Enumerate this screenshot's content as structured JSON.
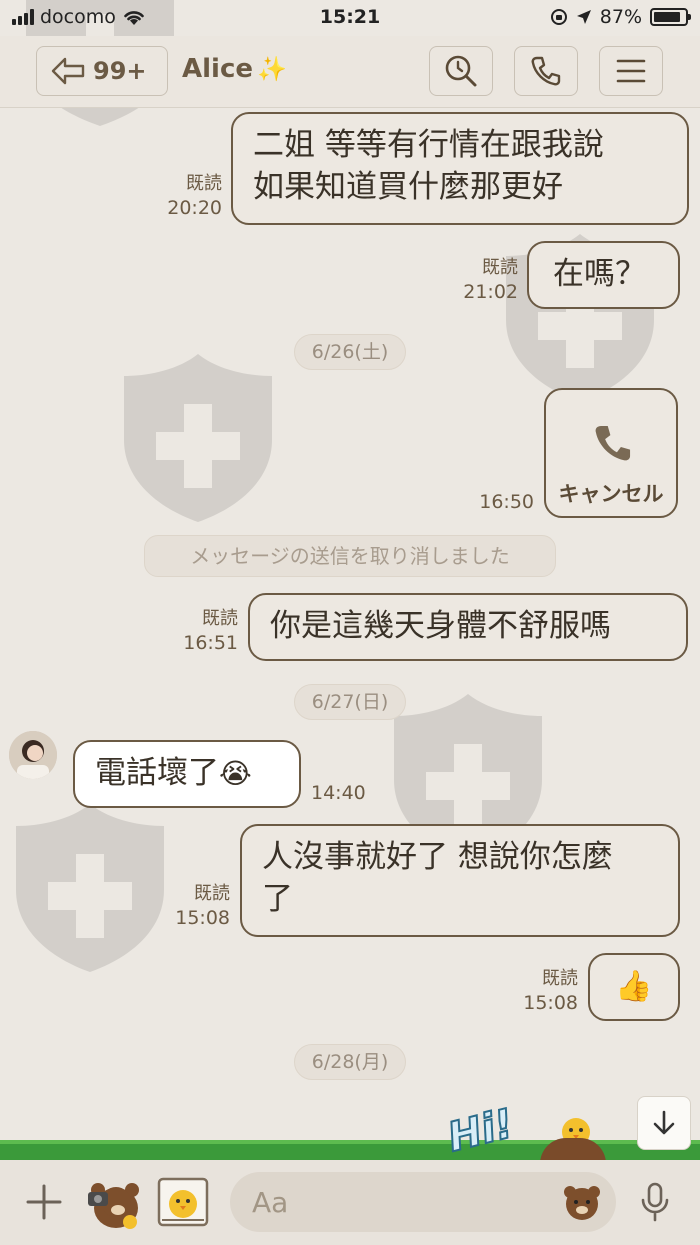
{
  "status_bar": {
    "carrier": "docomo",
    "time": "15:21",
    "battery_text": "87%",
    "battery_level": 0.87
  },
  "header": {
    "unread_count": "99+",
    "chat_name": "Alice",
    "title_emoji": "✨"
  },
  "messages": [
    {
      "line1": "二姐 等等有行情在跟我說",
      "line2": "如果知道買什麼那更好",
      "read": "既読",
      "time": "20:20"
    },
    {
      "text": "在嗎？",
      "read": "既読",
      "time": "21:02"
    },
    {
      "date": "6/26(土)"
    },
    {
      "call_label": "キャンセル",
      "time": "16:50",
      "icon": "phone-icon"
    },
    {
      "system": "メッセージの送信を取り消しました"
    },
    {
      "text": "你是這幾天身體不舒服嗎",
      "read": "既読",
      "time": "16:51"
    },
    {
      "date": "6/27(日)"
    },
    {
      "text": "電話壞了",
      "emoji": "😭",
      "time": "14:40"
    },
    {
      "line1": "人沒事就好了 想說你怎麼",
      "line2": "了",
      "read": "既読",
      "time": "15:08"
    },
    {
      "emoji": "👍",
      "read": "既読",
      "time": "15:08"
    },
    {
      "date": "6/28(月)"
    }
  ],
  "composer": {
    "placeholder": "Aa"
  },
  "sticker_banner": {
    "text": "Hi!"
  }
}
